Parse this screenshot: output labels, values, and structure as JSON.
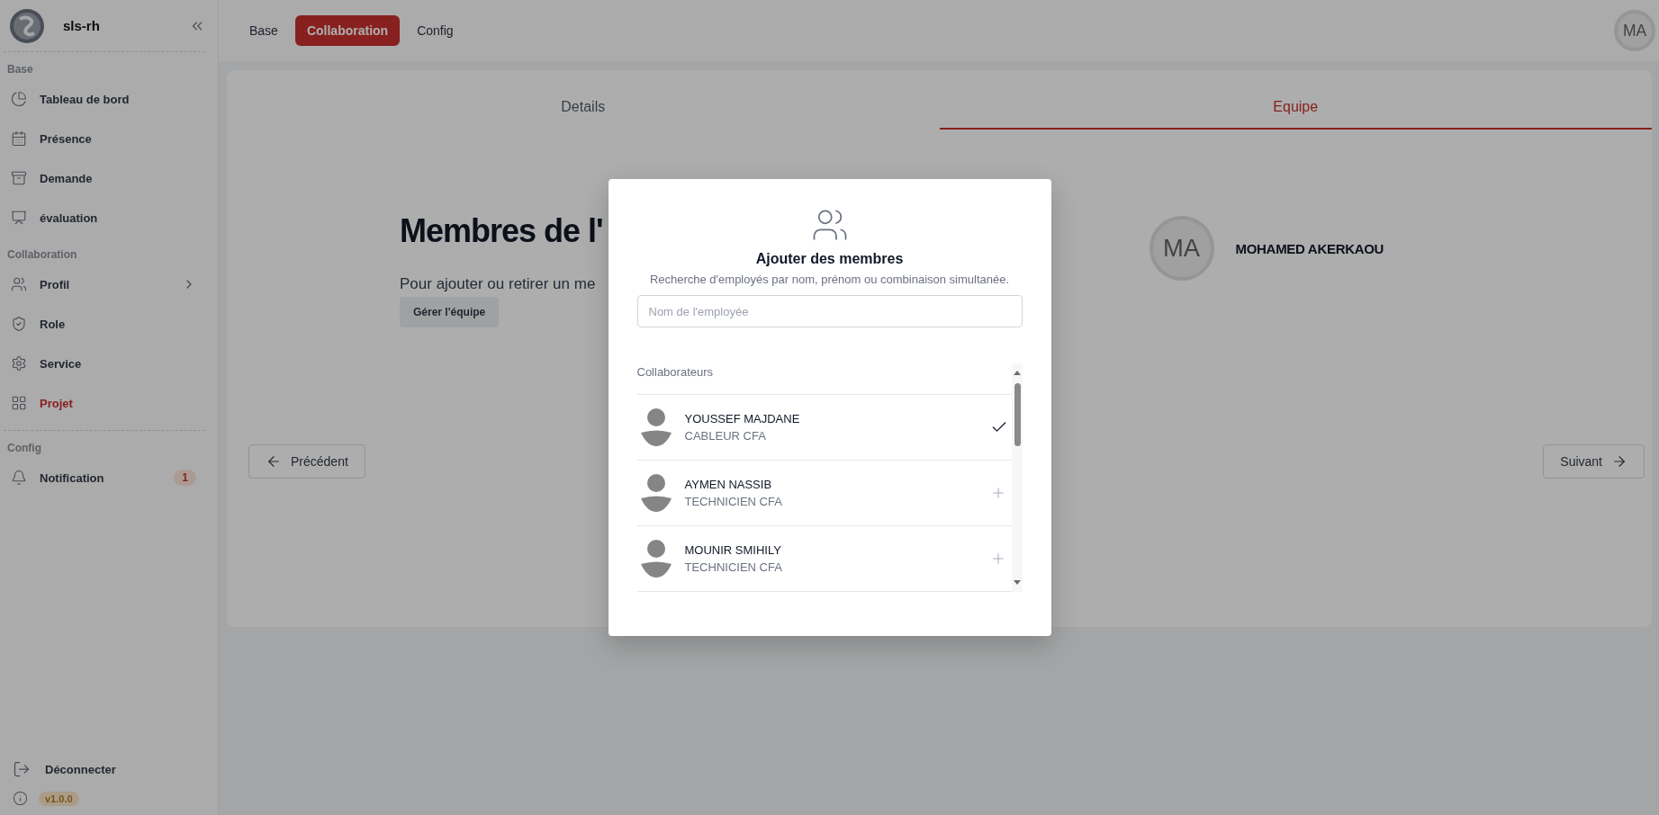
{
  "sidebar": {
    "brand": "sls-rh",
    "sections": [
      {
        "title": "Base",
        "items": [
          {
            "label": "Tableau de bord",
            "kind": "link",
            "selected": false
          },
          {
            "label": "Présence",
            "kind": "link",
            "selected": false
          },
          {
            "label": "Demande",
            "kind": "link",
            "selected": false
          },
          {
            "label": "évaluation",
            "kind": "link",
            "selected": false
          }
        ]
      },
      {
        "title": "Collaboration",
        "items": [
          {
            "label": "Profil",
            "kind": "submenu",
            "selected": false
          },
          {
            "label": "Role",
            "kind": "link",
            "selected": false
          },
          {
            "label": "Service",
            "kind": "link",
            "selected": false
          },
          {
            "label": "Projet",
            "kind": "link",
            "selected": true
          }
        ]
      },
      {
        "title": "Config",
        "items": [
          {
            "label": "Notification",
            "kind": "link",
            "selected": false,
            "badge": "1"
          }
        ]
      }
    ],
    "logout": "Déconnecter",
    "version": "v1.0.0"
  },
  "topbar": {
    "tabs": [
      {
        "label": "Base",
        "selected": false
      },
      {
        "label": "Collaboration",
        "selected": true
      },
      {
        "label": "Config",
        "selected": false
      }
    ],
    "avatar": "MA"
  },
  "page": {
    "tabs": [
      {
        "label": "Details",
        "selected": false
      },
      {
        "label": "Equipe",
        "selected": true
      }
    ],
    "heading": "Membres de l'",
    "text": "Pour ajouter ou retirer un me",
    "manage_button": "Gérer l'équipe",
    "members": [
      {
        "initials": "MA",
        "name": "MOHAMED AKERKAOU"
      }
    ],
    "prev_button": "Précédent",
    "next_button": "Suivant"
  },
  "modal": {
    "title": "Ajouter des membres",
    "subtitle": "Recherche d'employés par nom, prénom ou combinaison simultanée.",
    "search": {
      "placeholder": "Nom de l'employée"
    },
    "list_title": "Collaborateurs",
    "employees": [
      {
        "name": "YOUSSEF MAJDANE",
        "role": "CABLEUR CFA",
        "selected": true
      },
      {
        "name": "AYMEN NASSIB",
        "role": "TECHNICIEN CFA",
        "selected": false
      },
      {
        "name": "MOUNIR SMIHILY",
        "role": "TECHNICIEN CFA",
        "selected": false
      }
    ]
  }
}
